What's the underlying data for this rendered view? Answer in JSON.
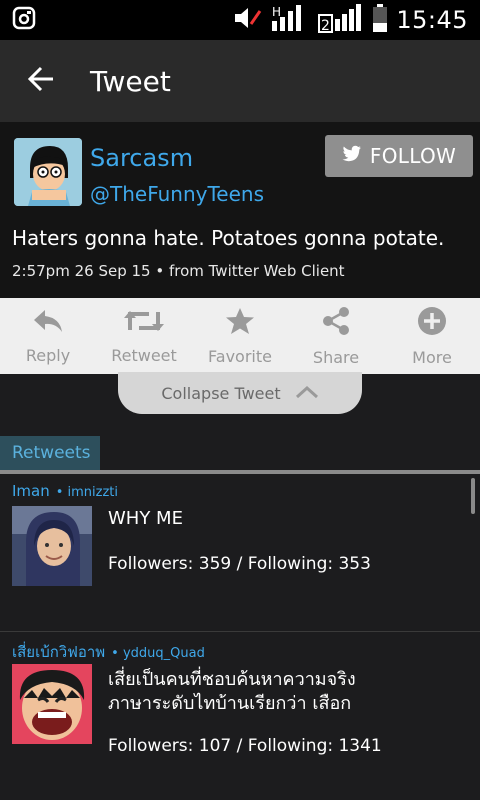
{
  "status": {
    "time": "15:45"
  },
  "header": {
    "title": "Tweet"
  },
  "tweet": {
    "author_name": "Sarcasm",
    "author_handle": "@TheFunnyTeens",
    "follow_label": "FOLLOW",
    "text": "Haters gonna hate. Potatoes gonna potate.",
    "meta": "2:57pm 26 Sep 15 • from Twitter Web Client"
  },
  "actions": [
    {
      "label": "Reply",
      "icon": "reply-icon"
    },
    {
      "label": "Retweet",
      "icon": "retweet-icon"
    },
    {
      "label": "Favorite",
      "icon": "star-icon"
    },
    {
      "label": "Share",
      "icon": "share-icon"
    },
    {
      "label": "More",
      "icon": "plus-circle-icon"
    }
  ],
  "collapse_label": "Collapse Tweet",
  "tabs": {
    "retweets": "Retweets"
  },
  "retweets": [
    {
      "name": "Iman",
      "handle": "• imnizzti",
      "text": "WHY ME",
      "text2": "",
      "followers": "Followers: 359 / Following: 353"
    },
    {
      "name": "เสี่ยเบ้กวิฟอาพ",
      "handle": "• ydduq_Quad",
      "text": "เสี่ยเป็นคนที่ชอบค้นหาความจริง",
      "text2": "ภาษาระดับไทบ้านเรียกว่า เสือก",
      "followers": "Followers: 107 / Following: 1341"
    }
  ]
}
